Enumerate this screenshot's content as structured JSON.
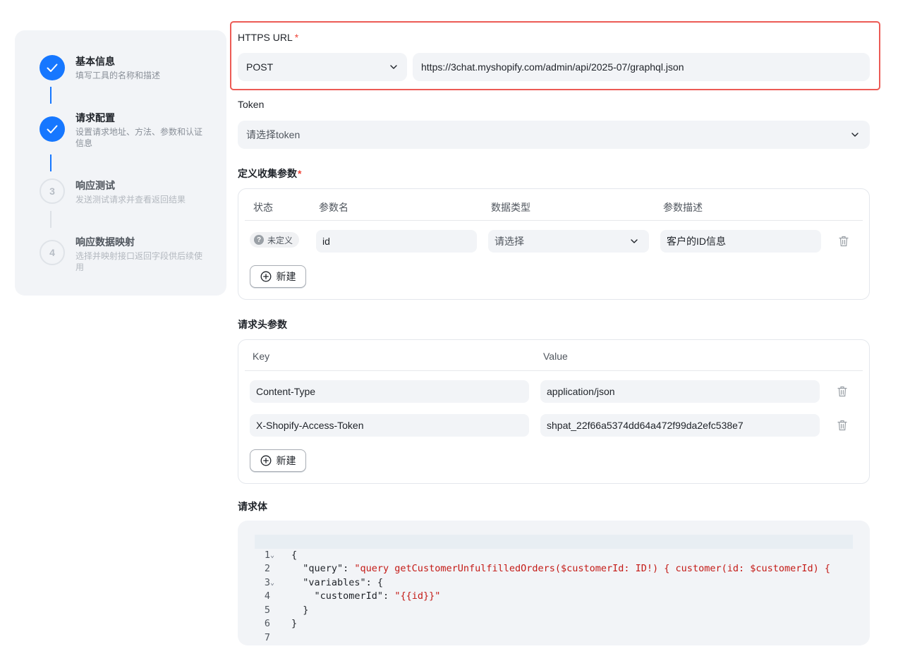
{
  "stepper": {
    "steps": [
      {
        "title": "基本信息",
        "desc": "填写工具的名称和描述",
        "status": "done"
      },
      {
        "title": "请求配置",
        "desc": "设置请求地址、方法、参数和认证信息",
        "status": "done"
      },
      {
        "title": "响应测试",
        "desc": "发送测试请求并查看返回结果",
        "status": "todo",
        "number": "3"
      },
      {
        "title": "响应数据映射",
        "desc": "选择并映射接口返回字段供后续使用",
        "status": "todo",
        "number": "4"
      }
    ]
  },
  "url": {
    "label": "HTTPS URL",
    "required_mark": "*",
    "method": "POST",
    "value": "https://3chat.myshopify.com/admin/api/2025-07/graphql.json"
  },
  "token": {
    "label": "Token",
    "placeholder": "请选择token"
  },
  "params": {
    "label": "定义收集参数",
    "required_mark": "*",
    "headers": [
      "状态",
      "参数名",
      "数据类型",
      "参数描述"
    ],
    "rows": [
      {
        "status": "未定义",
        "status_icon": "?",
        "name": "id",
        "type_placeholder": "请选择",
        "desc": "客户的ID信息"
      }
    ],
    "add_label": "新建"
  },
  "headers": {
    "label": "请求头参数",
    "columns": [
      "Key",
      "Value"
    ],
    "rows": [
      {
        "key": "Content-Type",
        "value": "application/json"
      },
      {
        "key": "X-Shopify-Access-Token",
        "value": "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"
      }
    ],
    "add_label": "新建"
  },
  "body": {
    "label": "请求体",
    "lines": [
      {
        "n": "1",
        "fold": true,
        "pre": "{",
        "str": ""
      },
      {
        "n": "2",
        "fold": false,
        "pre": "  \"query\": ",
        "str": "\"query getCustomerUnfulfilledOrders($customerId: ID!) { customer(id: $customerId) {"
      },
      {
        "n": "3",
        "fold": true,
        "pre": "  \"variables\": {",
        "str": ""
      },
      {
        "n": "4",
        "fold": false,
        "pre": "    \"customerId\": ",
        "str": "\"{{id}}\""
      },
      {
        "n": "5",
        "fold": false,
        "pre": "  }",
        "str": ""
      },
      {
        "n": "6",
        "fold": false,
        "pre": "}",
        "str": ""
      },
      {
        "n": "7",
        "fold": false,
        "pre": "",
        "str": ""
      }
    ]
  },
  "colors": {
    "primary": "#1677ff",
    "required": "#f04438",
    "highlight_border": "#ec5b55",
    "input_bg": "#f2f4f7",
    "code_string": "#c41a16"
  }
}
